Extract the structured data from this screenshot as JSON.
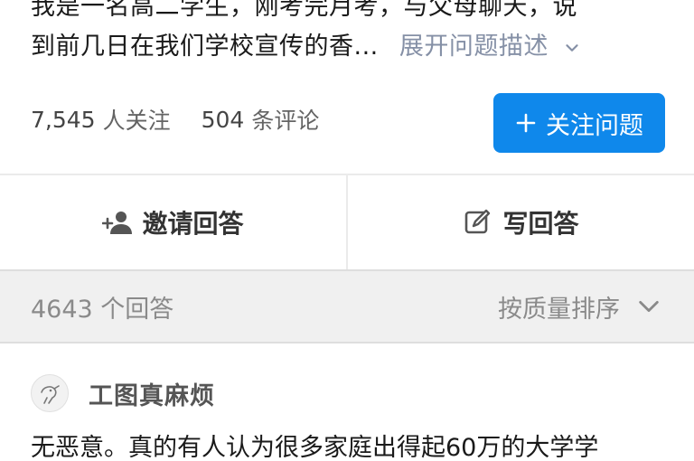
{
  "question": {
    "description_lines": [
      "我是一名高二学生，刚考完月考，与父母聊天，说",
      "到前几日在我们学校宣传的香..."
    ],
    "expand_label": "展开问题描述"
  },
  "stats": {
    "followers_count": "7,545",
    "followers_label": "人关注",
    "comments_count": "504",
    "comments_label": "条评论"
  },
  "follow_button": {
    "label": "关注问题"
  },
  "actions": {
    "invite_label": "邀请回答",
    "write_label": "写回答"
  },
  "answers": {
    "count_label": "4643 个回答",
    "sort_label": "按质量排序"
  },
  "first_answer": {
    "author": "工图真麻烦",
    "excerpt": "无恶意。真的有人认为很多家庭出得起60万的大学学"
  },
  "colors": {
    "accent": "#0f88eb",
    "muted": "#8590a6",
    "bar_bg": "#f0f0f0"
  }
}
